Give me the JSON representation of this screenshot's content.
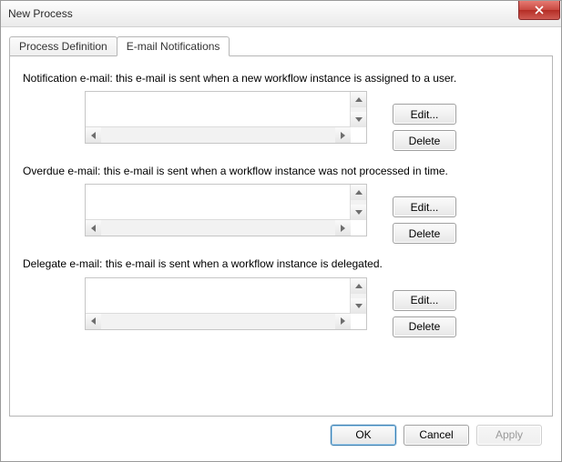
{
  "window": {
    "title": "New Process"
  },
  "tabs": {
    "definition_label": "Process Definition",
    "email_label": "E-mail Notifications"
  },
  "sections": {
    "notification": {
      "label": "Notification e-mail: this e-mail is sent when a new workflow instance is assigned to a user.",
      "value": "",
      "edit_label": "Edit...",
      "delete_label": "Delete"
    },
    "overdue": {
      "label": "Overdue e-mail: this e-mail is sent when a workflow instance was not processed in time.",
      "value": "",
      "edit_label": "Edit...",
      "delete_label": "Delete"
    },
    "delegate": {
      "label": "Delegate e-mail: this e-mail is sent when a workflow instance is delegated.",
      "value": "",
      "edit_label": "Edit...",
      "delete_label": "Delete"
    }
  },
  "buttons": {
    "ok": "OK",
    "cancel": "Cancel",
    "apply": "Apply"
  }
}
